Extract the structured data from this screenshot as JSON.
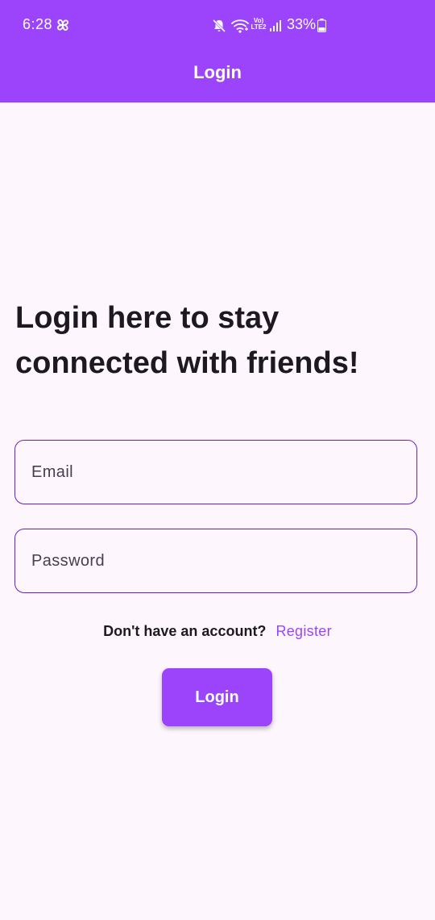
{
  "status_bar": {
    "time": "6:28",
    "network_label": "Vo) LTE2",
    "battery": "33%"
  },
  "app_bar": {
    "title": "Login"
  },
  "main": {
    "heading": "Login here to stay connected with friends!",
    "email_placeholder": "Email",
    "password_placeholder": "Password",
    "register_prompt": "Don't have an account?",
    "register_link": "Register",
    "login_button": "Login"
  },
  "colors": {
    "primary": "#9b44fb",
    "field_border": "#6a1fc4",
    "background": "#fdf7fd",
    "text": "#1c1a20"
  },
  "icons": [
    "pinwheel-icon",
    "mute-icon",
    "wifi-icon",
    "signal-icon",
    "battery-icon"
  ]
}
